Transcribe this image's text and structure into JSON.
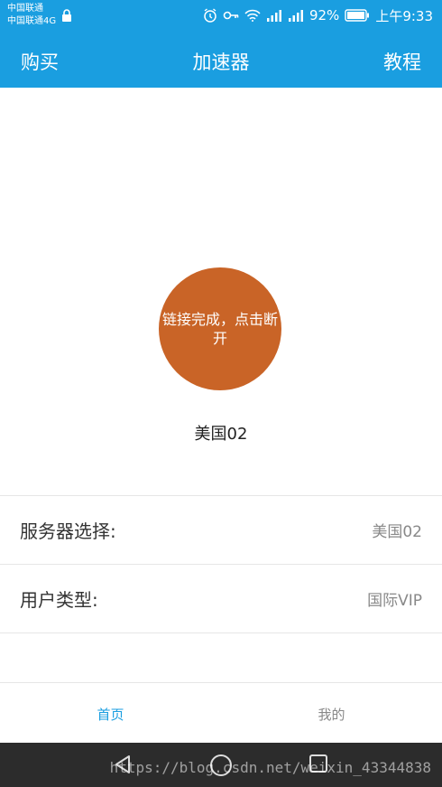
{
  "status_bar": {
    "carrier_1": "中国联通",
    "carrier_2": "中国联通4G",
    "battery": "92%",
    "time": "上午9:33",
    "icons": [
      "lock-icon",
      "alarm-icon",
      "key-icon",
      "wifi-icon",
      "signal-icon",
      "battery-icon"
    ]
  },
  "nav": {
    "left": "购买",
    "title": "加速器",
    "right": "教程",
    "accent": "#1a9ee0"
  },
  "connect": {
    "label": "链接完成，点击断开",
    "color": "#c96427"
  },
  "server_caption": "美国02",
  "rows": [
    {
      "label": "服务器选择:",
      "value": "美国02"
    },
    {
      "label": "用户类型:",
      "value": "国际VIP"
    }
  ],
  "tabs": [
    {
      "label": "首页",
      "active": true
    },
    {
      "label": "我的",
      "active": false
    }
  ],
  "system_nav": {
    "icons": [
      "back-icon",
      "home-icon",
      "recents-icon"
    ],
    "watermark": "https://blog.csdn.net/weixin_43344838"
  }
}
